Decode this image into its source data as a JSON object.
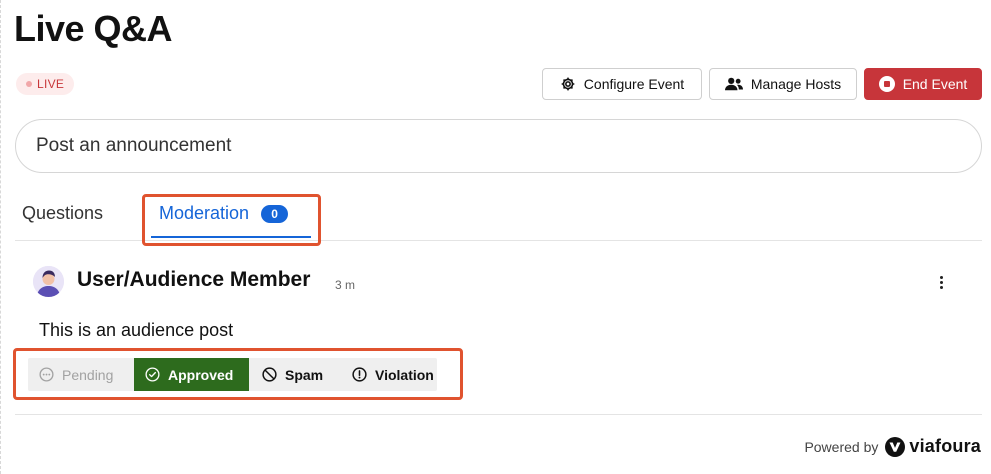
{
  "page": {
    "title": "Live Q&A"
  },
  "status": {
    "live_label": "LIVE"
  },
  "toolbar": {
    "configure_label": "Configure Event",
    "hosts_label": "Manage Hosts",
    "end_label": "End Event"
  },
  "announcement": {
    "placeholder": "Post an announcement"
  },
  "tabs": [
    {
      "label": "Questions",
      "active": false
    },
    {
      "label": "Moderation",
      "active": true,
      "count": "0"
    }
  ],
  "post": {
    "author": "User/Audience Member",
    "time": "3 m",
    "body": "This is an audience post",
    "actions": [
      {
        "label": "Pending",
        "state": "disabled"
      },
      {
        "label": "Approved",
        "state": "selected"
      },
      {
        "label": "Spam",
        "state": "default"
      },
      {
        "label": "Violation",
        "state": "default"
      }
    ]
  },
  "footer": {
    "powered_by": "Powered by",
    "brand": "viafoura"
  },
  "colors": {
    "live_text": "#c8373a",
    "live_bg": "#fdecec",
    "danger": "#c7353a",
    "accent": "#1565d8",
    "approved": "#2d6b1d",
    "highlight": "#e0532f"
  },
  "icons": {
    "configure": "gear-icon",
    "hosts": "users-icon",
    "end": "stop-icon",
    "pending": "ellipsis-circle-icon",
    "approved": "check-circle-icon",
    "spam": "ban-icon",
    "violation": "exclamation-circle-icon",
    "more": "kebab-icon",
    "brand": "viafoura-logo-icon"
  }
}
